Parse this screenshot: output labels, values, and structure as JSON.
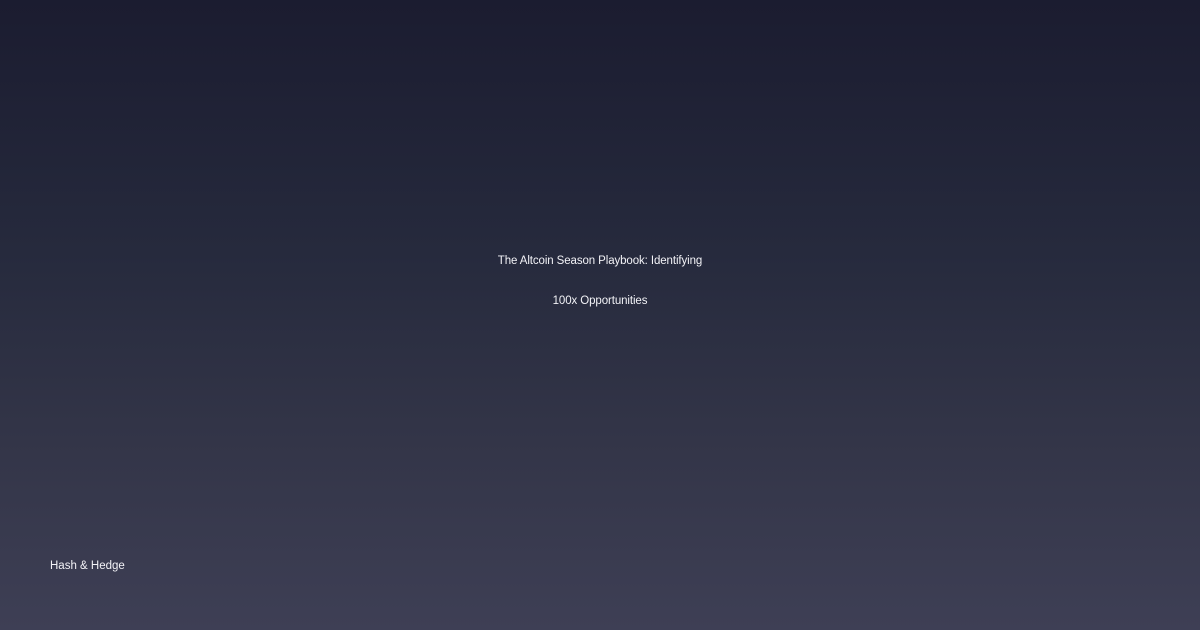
{
  "card": {
    "title_lines": [
      "The Altcoin Season Playbook: Identifying",
      "100x Opportunities"
    ],
    "brand": "Hash & Hedge"
  },
  "colors": {
    "background_top": "#1b1c30",
    "background_bottom": "#3e3f55",
    "text": "#f2f2f6"
  }
}
